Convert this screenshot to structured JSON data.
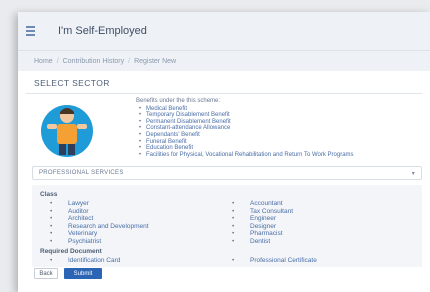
{
  "header": {
    "title": "I'm Self-Employed"
  },
  "breadcrumb": [
    "Home",
    "Contribution History",
    "Register New"
  ],
  "page": {
    "section_title": "SELECT SECTOR"
  },
  "benefits": {
    "intro": "Benefits under the this scheme:",
    "items": [
      "Medical Benefit",
      "Temporary Disablement Benefit",
      "Permanent Disablement Benefit",
      "Constant-attendance Allowance",
      "Dependants' Benefit",
      "Funeral Benefit",
      "Education Benefit",
      "Facilities for Physical, Vocational Rehabilitation and Return To Work Programs"
    ]
  },
  "sector_select": {
    "value": "PROFESSIONAL SERVICES"
  },
  "class_section": {
    "heading": "Class",
    "left": [
      "Lawyer",
      "Auditor",
      "Architect",
      "Research and Development",
      "Veterinary",
      "Psychiatrist"
    ],
    "right": [
      "Accountant",
      "Tax Consultant",
      "Engineer",
      "Designer",
      "Pharmacist",
      "Dentist"
    ]
  },
  "required_docs": {
    "heading": "Required Document",
    "left": [
      "Identification Card"
    ],
    "right": [
      "Professional Certificate"
    ]
  },
  "buttons": {
    "back": "Back",
    "submit": "Submit"
  },
  "colors": {
    "accent": "#2b63b5",
    "link": "#4a6ea8",
    "topbar": "#eef1f6"
  },
  "icons": {
    "menu": "hamburger-menu-icon",
    "dropdown": "chevron-down-icon",
    "illustration": "worker-illustration"
  }
}
